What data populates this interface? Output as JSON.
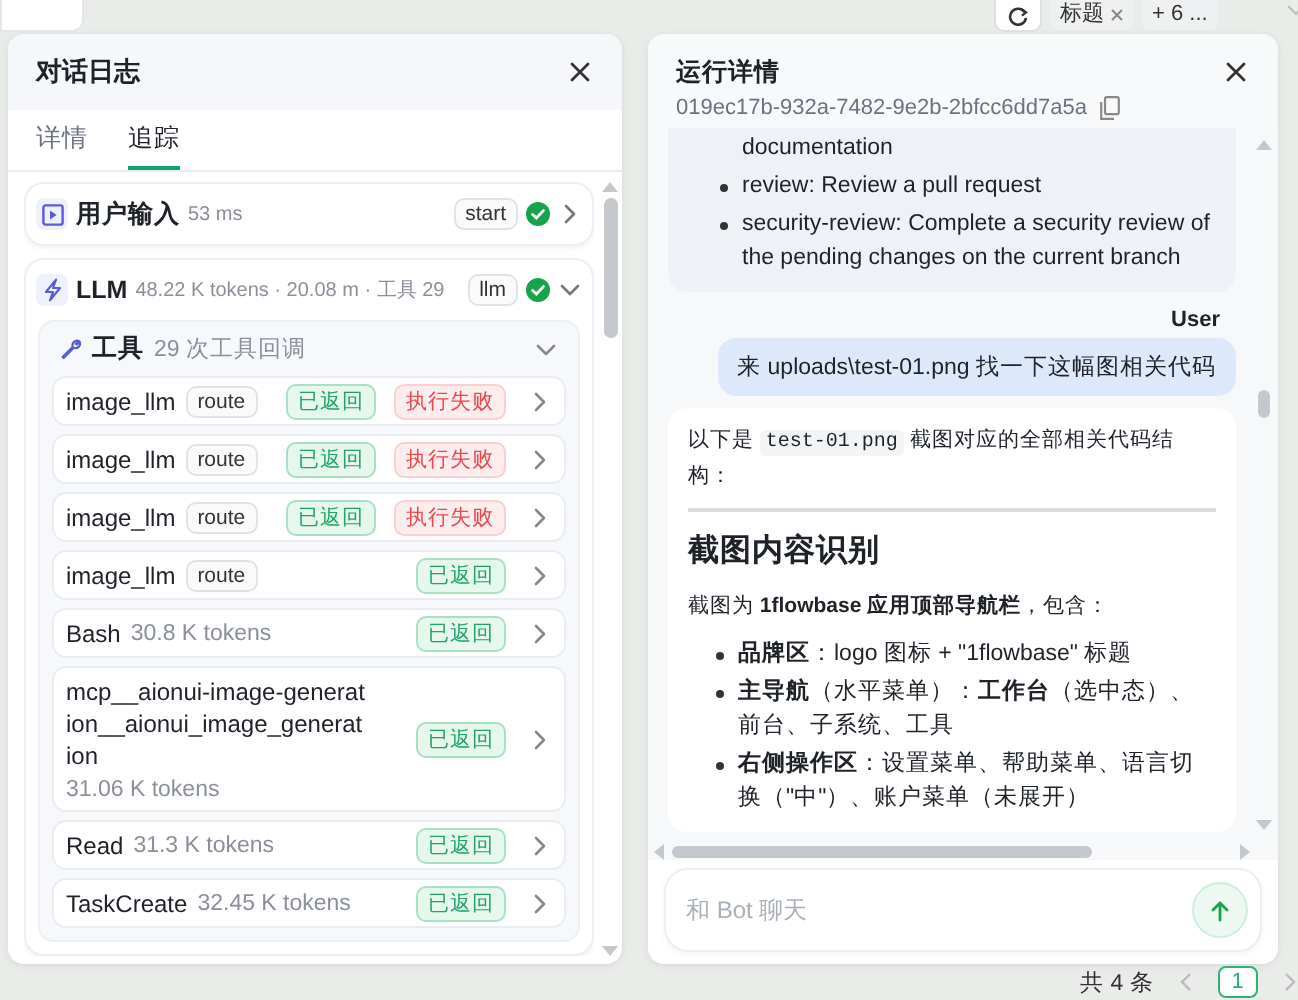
{
  "toolbar": {
    "tabs": [
      {
        "label": "标题",
        "closable": true
      }
    ],
    "overflow": "+ 6 ..."
  },
  "trace_panel": {
    "title": "对话日志",
    "tabs": [
      {
        "label": "详情",
        "selected": false
      },
      {
        "label": "追踪",
        "selected": true
      }
    ],
    "spans": [
      {
        "kind": "input",
        "title": "用户输入",
        "meta": "53 ms",
        "tag": "start",
        "success": true,
        "expanded": false
      },
      {
        "kind": "llm",
        "title": "LLM",
        "meta": "48.22 K tokens · 20.08 m · 工具 29",
        "tag": "llm",
        "success": true,
        "expanded": true,
        "tool_group": {
          "title": "工具",
          "meta": "29 次工具回调",
          "expanded": true,
          "calls": [
            {
              "kind": "tagged",
              "name": "image_llm",
              "tag": "route",
              "status": "已返回",
              "error": "执行失败"
            },
            {
              "kind": "tagged",
              "name": "image_llm",
              "tag": "route",
              "status": "已返回",
              "error": "执行失败"
            },
            {
              "kind": "tagged",
              "name": "image_llm",
              "tag": "route",
              "status": "已返回",
              "error": "执行失败"
            },
            {
              "kind": "tagged",
              "name": "image_llm",
              "tag": "route",
              "status": "已返回"
            },
            {
              "kind": "inline",
              "name": "Bash",
              "meta": "30.8 K tokens",
              "status": "已返回"
            },
            {
              "kind": "stacked",
              "name": "mcp__aionui-image-generation__aionui_image_generation",
              "meta": "31.06 K tokens",
              "status": "已返回"
            },
            {
              "kind": "inline",
              "name": "Read",
              "meta": "31.3 K tokens",
              "status": "已返回"
            },
            {
              "kind": "inline",
              "name": "TaskCreate",
              "meta": "32.45 K tokens",
              "status": "已返回"
            }
          ]
        }
      }
    ]
  },
  "run_panel": {
    "title": "运行详情",
    "run_id": "019ec17b-932a-7482-9e2b-2bfcc6dd7a5a",
    "messages": [
      {
        "kind": "assistant_bubble",
        "items": [
          {
            "text": "documentation",
            "bullet": false
          },
          {
            "text": "review: Review a pull request",
            "bullet": true
          },
          {
            "text": "security-review: Complete a security review of the pending changes on the current branch",
            "bullet": true
          }
        ]
      },
      {
        "kind": "user",
        "author": "User",
        "text": "来 uploads\\test-01.png 找一下这幅图相关代码"
      },
      {
        "kind": "assistant_card",
        "blocks": [
          {
            "kind": "paragraph",
            "parts": [
              {
                "kind": "text",
                "text": "以下是 "
              },
              {
                "kind": "code",
                "text": "test-01.png"
              },
              {
                "kind": "text",
                "text": " 截图对应的全部相关代码结构："
              }
            ]
          },
          {
            "kind": "rule"
          },
          {
            "kind": "heading",
            "text": "截图内容识别"
          },
          {
            "kind": "paragraph",
            "parts": [
              {
                "kind": "text",
                "text": "截图为 **1flowbase 应用顶部导航栏**，包含："
              }
            ]
          },
          {
            "kind": "list",
            "items": [
              "**品牌区**：logo 图标 + \"1flowbase\" 标题",
              "**主导航**（水平菜单）：**工作台**（选中态）、前台、子系统、工具",
              "**右侧操作区**：设置菜单、帮助菜单、语言切换（\"中\"）、账户菜单（未展开）"
            ]
          }
        ]
      }
    ],
    "composer": {
      "placeholder": "和 Bot 聊天"
    }
  },
  "pagination": {
    "total": "共 4 条",
    "pages": [
      {
        "label": "1",
        "selected": true
      }
    ]
  }
}
